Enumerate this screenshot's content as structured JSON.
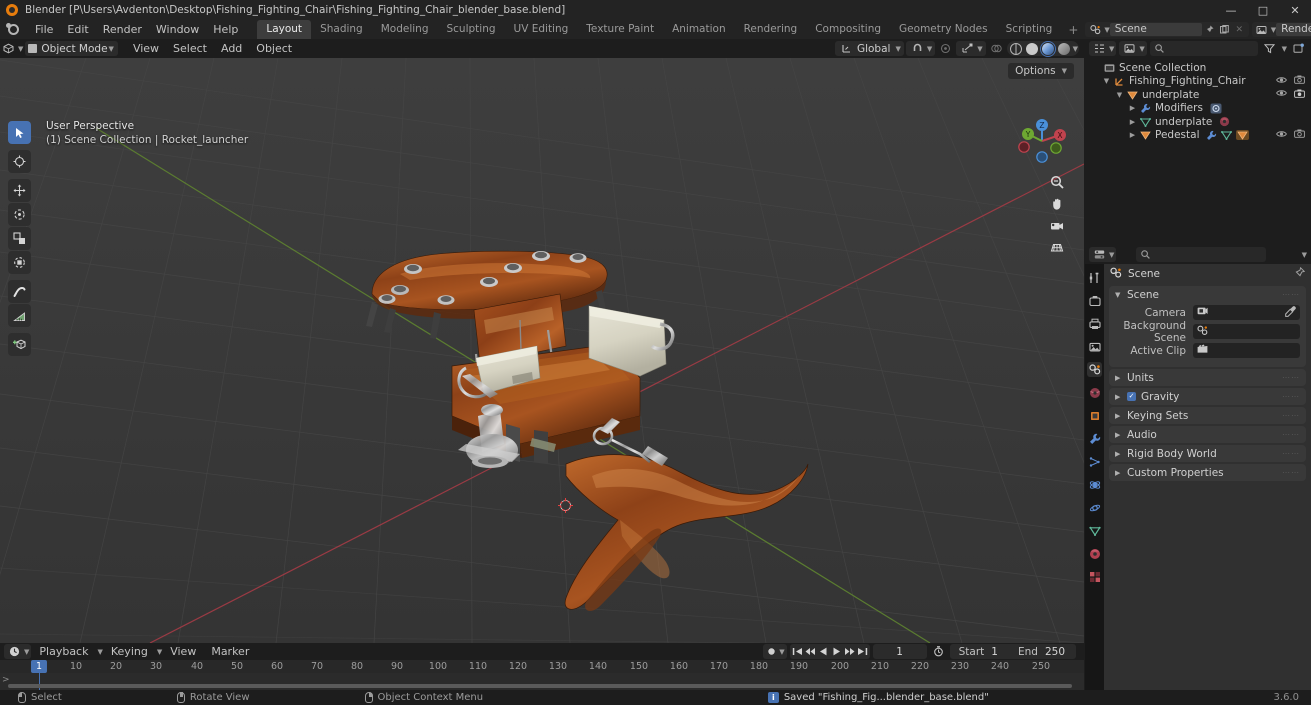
{
  "window": {
    "title": "Blender [P\\Users\\Avdenton\\Desktop\\Fishing_Fighting_Chair\\Fishing_Fighting_Chair_blender_base.blend]",
    "minimize": "—",
    "maximize": "□",
    "close": "✕"
  },
  "topbar": {
    "menus": [
      "File",
      "Edit",
      "Render",
      "Window",
      "Help"
    ],
    "workspaces": [
      {
        "label": "Layout",
        "active": true
      },
      {
        "label": "Shading",
        "active": false
      },
      {
        "label": "Modeling",
        "active": false
      },
      {
        "label": "Sculpting",
        "active": false
      },
      {
        "label": "UV Editing",
        "active": false
      },
      {
        "label": "Texture Paint",
        "active": false
      },
      {
        "label": "Animation",
        "active": false
      },
      {
        "label": "Rendering",
        "active": false
      },
      {
        "label": "Compositing",
        "active": false
      },
      {
        "label": "Geometry Nodes",
        "active": false
      },
      {
        "label": "Scripting",
        "active": false
      }
    ],
    "add_workspace": "+",
    "scene_name": "Scene",
    "viewlayer_name": "RenderLayer"
  },
  "viewport": {
    "mode": "Object Mode",
    "menus": [
      "View",
      "Select",
      "Add",
      "Object"
    ],
    "transform_orientation": "Global",
    "options_label": "Options",
    "overlay_line1": "User Perspective",
    "overlay_line2": "(1) Scene Collection | Rocket_launcher",
    "gizmo_axes": [
      "X",
      "Y",
      "Z"
    ],
    "tools": [
      {
        "name": "tweak-select-tool",
        "active": true
      },
      {
        "name": "cursor-tool",
        "active": false
      },
      {
        "name": "move-tool",
        "active": false
      },
      {
        "name": "rotate-tool",
        "active": false
      },
      {
        "name": "scale-tool",
        "active": false
      },
      {
        "name": "transform-tool",
        "active": false
      },
      {
        "name": "annotate-tool",
        "active": false
      },
      {
        "name": "measure-tool",
        "active": false
      },
      {
        "name": "add-cube-tool",
        "active": false
      }
    ],
    "shading_modes": [
      "wireframe",
      "solid",
      "material-preview",
      "rendered"
    ],
    "active_shading": "material-preview"
  },
  "outliner": {
    "search_placeholder": "",
    "rows": [
      {
        "label": "Scene Collection",
        "depth": 0,
        "icon": "collection",
        "disclosure": "",
        "visibility": false
      },
      {
        "label": "Fishing_Fighting_Chair",
        "depth": 1,
        "icon": "empty-axes",
        "disclosure": "▼",
        "visibility": true
      },
      {
        "label": "underplate",
        "depth": 2,
        "icon": "mesh-object",
        "disclosure": "▼",
        "visibility": true
      },
      {
        "label": "Modifiers",
        "depth": 3,
        "icon": "wrench",
        "disclosure": "▶",
        "visibility": false
      },
      {
        "label": "underplate",
        "depth": 3,
        "icon": "mesh-data",
        "disclosure": "▶",
        "visibility": false
      },
      {
        "label": "Pedestal",
        "depth": 3,
        "icon": "mesh-object",
        "disclosure": "▶",
        "visibility": true
      }
    ]
  },
  "properties": {
    "search_placeholder": "",
    "breadcrumb": "Scene",
    "tabs": [
      "tool",
      "render",
      "output",
      "view-layer",
      "scene",
      "world",
      "object",
      "modifiers",
      "particles",
      "physics",
      "constraints",
      "object-data",
      "material",
      "texture"
    ],
    "active_tab": "scene",
    "panels": [
      {
        "title": "Scene",
        "open": true,
        "checkbox": false
      },
      {
        "title": "Units",
        "open": false,
        "checkbox": false
      },
      {
        "title": "Gravity",
        "open": false,
        "checkbox": true
      },
      {
        "title": "Keying Sets",
        "open": false,
        "checkbox": false
      },
      {
        "title": "Audio",
        "open": false,
        "checkbox": false
      },
      {
        "title": "Rigid Body World",
        "open": false,
        "checkbox": false
      },
      {
        "title": "Custom Properties",
        "open": false,
        "checkbox": false
      }
    ],
    "scene_fields": [
      {
        "label": "Camera",
        "value": "",
        "icon": "camera"
      },
      {
        "label": "Background Scene",
        "value": "",
        "icon": "scene"
      },
      {
        "label": "Active Clip",
        "value": "",
        "icon": "clip"
      }
    ]
  },
  "timeline": {
    "menus": [
      "Playback",
      "Keying",
      "View",
      "Marker"
    ],
    "current_frame": "1",
    "start_label": "Start",
    "start_value": "1",
    "end_label": "End",
    "end_value": "250",
    "ruler_ticks": [
      "10",
      "20",
      "30",
      "40",
      "50",
      "60",
      "70",
      "80",
      "90",
      "100",
      "110",
      "120",
      "130",
      "140",
      "150",
      "160",
      "170",
      "180",
      "190",
      "200",
      "210",
      "220",
      "230",
      "240",
      "250"
    ],
    "playhead_label": "1"
  },
  "statusbar": {
    "hints": [
      {
        "mouse": "lmb",
        "label": "Select"
      },
      {
        "mouse": "mmb",
        "label": "Rotate View"
      },
      {
        "mouse": "rmb",
        "label": "Object Context Menu"
      }
    ],
    "saved_message": "Saved \"Fishing_Fig...blender_base.blend\"",
    "version": "3.6.0"
  },
  "colors": {
    "accent": "#4772b3",
    "orange": "#e87d0d",
    "viewport_bg": "#393939",
    "axis_x": "#9b3b45",
    "axis_y": "#5a7d2e",
    "panel_bg": "#303030",
    "header_bg": "#1d1d1d",
    "wood": "#8c3f17",
    "cushion": "#d8d6c6"
  }
}
